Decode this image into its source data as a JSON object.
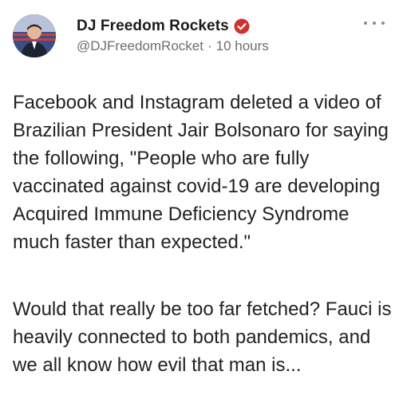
{
  "post": {
    "display_name": "DJ Freedom Rockets",
    "handle": "@DJFreedomRocket",
    "separator": "·",
    "time": "10 hours",
    "paragraphs": [
      "Facebook and Instagram deleted a video of Brazilian President Jair Bolsonaro for saying the following, \"People who are fully vaccinated against covid-19 are developing Acquired Immune Deficiency Syndrome much faster than expected.\"",
      "Would that really be too far fetched? Fauci is heavily connected to both pandemics, and we all know how evil that man is..."
    ]
  },
  "colors": {
    "verified_badge": "#d0312d",
    "handle_text": "#6e6e6e",
    "body_text": "#222222"
  },
  "icons": {
    "avatar": "profile-photo",
    "verified": "verified-check-badge",
    "more": "three-dots-more"
  }
}
